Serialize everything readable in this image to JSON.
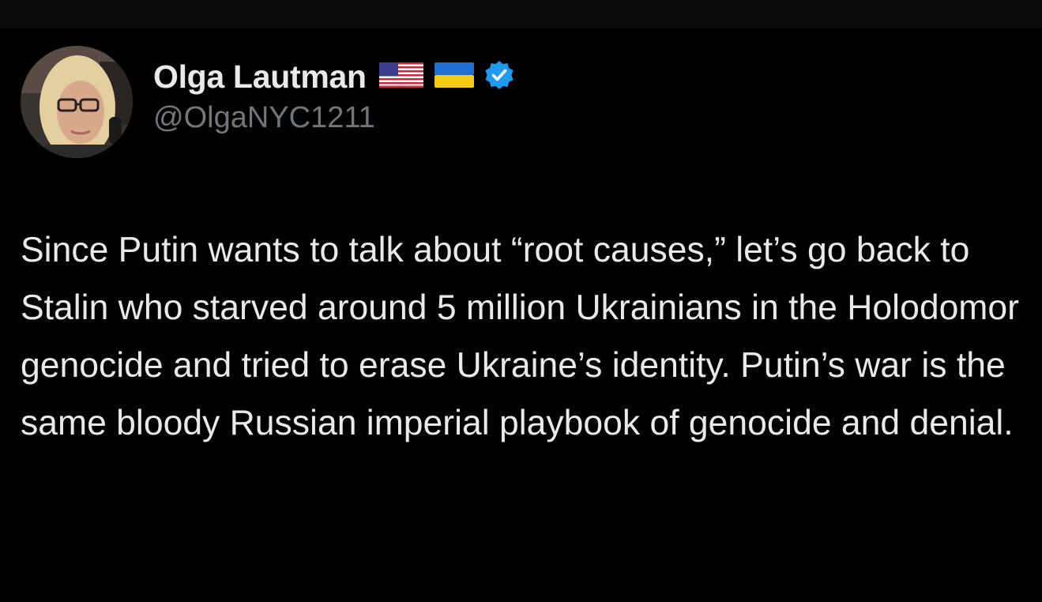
{
  "tweet": {
    "author": {
      "display_name": "Olga Lautman",
      "handle": "@OlgaNYC1211",
      "flags": [
        "us-flag-icon",
        "ukraine-flag-icon"
      ],
      "verified_icon": "verified-badge-icon",
      "verified_color": "#1d9bf0"
    },
    "text": "Since Putin wants to talk about “root causes,” let’s go back to Stalin who starved around 5 million Ukrainians in the Holodomor genocide and tried to erase Ukraine’s identity. Putin’s war is the same bloody Russian imperial playbook of genocide and denial."
  },
  "colors": {
    "background": "#000000",
    "primary_text": "#e7e9ea",
    "secondary_text": "#71767b"
  }
}
